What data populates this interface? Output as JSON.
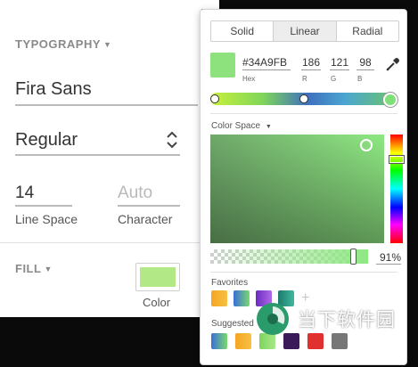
{
  "typography": {
    "section_title": "TYPOGRAPHY",
    "font_family": "Fira Sans",
    "font_weight": "Regular",
    "line_space_value": "14",
    "line_space_label": "Line Space",
    "character_placeholder": "Auto",
    "character_label": "Character"
  },
  "fill": {
    "section_title": "FILL",
    "swatch_color": "#b3e887",
    "color_label": "Color"
  },
  "picker": {
    "tabs": [
      {
        "label": "Solid",
        "active": false
      },
      {
        "label": "Linear",
        "active": true
      },
      {
        "label": "Radial",
        "active": false
      }
    ],
    "current_color": "#8ee27e",
    "hex_value": "#34A9FB",
    "hex_label": "Hex",
    "r_value": "186",
    "r_label": "R",
    "g_value": "121",
    "g_label": "G",
    "b_value": "98",
    "b_label": "B",
    "gradient_stop_positions": [
      0.0,
      0.5,
      1.0
    ],
    "color_space_label": "Color Space",
    "hue_level": 0.22,
    "opacity_fraction": 0.91,
    "opacity_text": "91%",
    "favorites_label": "Favorites",
    "favorites": [
      {
        "name": "orange-gradient",
        "color": "#f5a623",
        "color2": "#f7c042"
      },
      {
        "name": "blue-green-gradient",
        "color": "#3a6fd8",
        "color2": "#7ad86e"
      },
      {
        "name": "purple-gradient",
        "color": "#6a2bbf",
        "color2": "#b06ae8"
      },
      {
        "name": "teal-gradient",
        "color": "#1f7a6a",
        "color2": "#3fb8a0"
      }
    ],
    "suggested_label": "Suggested",
    "suggested": [
      {
        "name": "blue-green",
        "color": "#3a6fd8",
        "color2": "#7ad86e"
      },
      {
        "name": "orange",
        "color": "#f5a623",
        "color2": "#f7c042"
      },
      {
        "name": "light-green",
        "color": "#7dd45e",
        "color2": "#a8e888"
      },
      {
        "name": "dark-purple",
        "color": "#3b1a5a",
        "color2": "#3b1a5a"
      },
      {
        "name": "red",
        "color": "#e03030",
        "color2": "#e03030"
      },
      {
        "name": "gray",
        "color": "#777777",
        "color2": "#777777"
      }
    ]
  },
  "watermark": {
    "text": "当下软件园"
  },
  "icons": {
    "weight_stepper": "chevron-updown-icon",
    "eyedropper": "eyedropper-icon",
    "add_favorite": "plus-icon"
  }
}
